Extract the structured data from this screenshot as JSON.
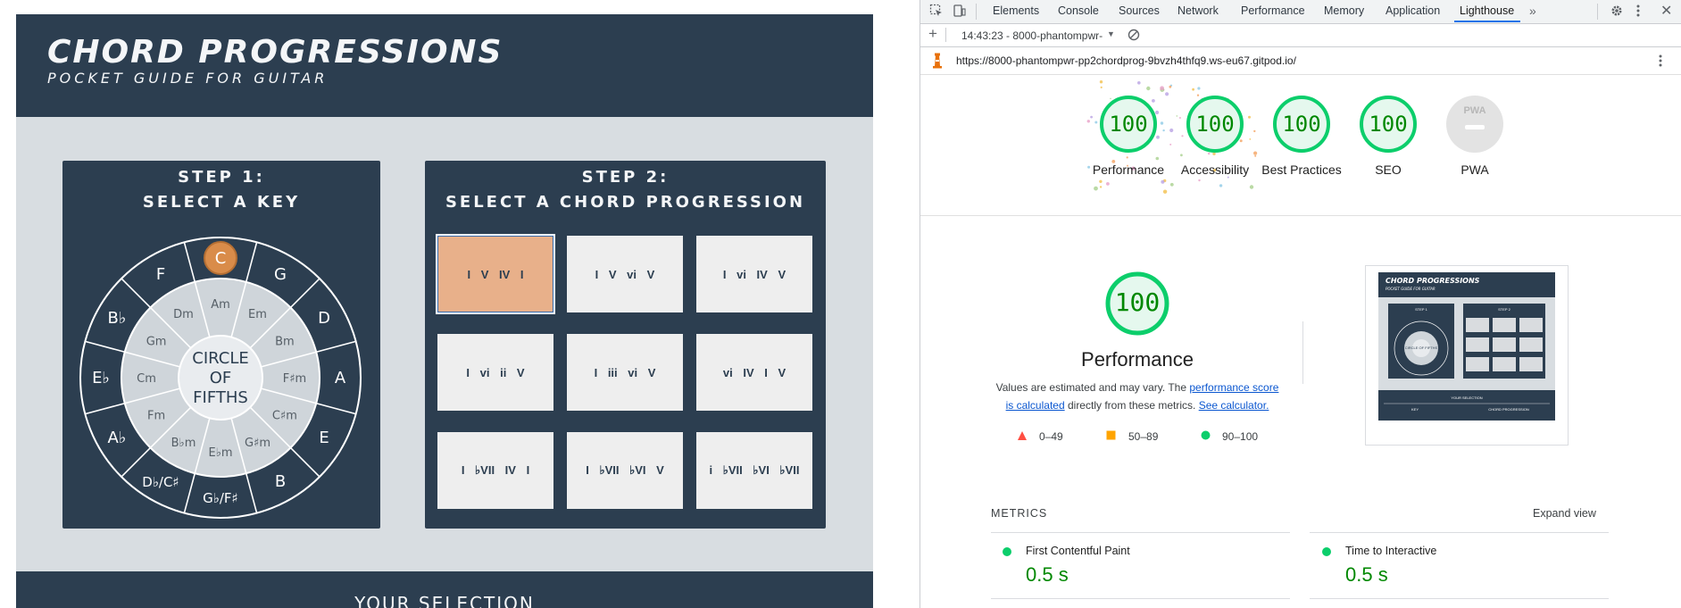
{
  "app": {
    "title": "CHORD PROGRESSIONS",
    "subtitle": "POCKET GUIDE FOR GUITAR",
    "step1": {
      "line1": "STEP 1:",
      "line2": "SELECT A KEY"
    },
    "step2": {
      "line1": "STEP 2:",
      "line2": "SELECT A CHORD PROGRESSION"
    },
    "wheel": {
      "center": [
        "CIRCLE",
        "OF",
        "FIFTHS"
      ],
      "major": [
        "C",
        "G",
        "D",
        "A",
        "E",
        "B",
        "G♭/F♯",
        "D♭/C♯",
        "A♭",
        "E♭",
        "B♭",
        "F"
      ],
      "minor": [
        "Am",
        "Em",
        "Bm",
        "F♯m",
        "C♯m",
        "G♯m",
        "E♭m",
        "B♭m",
        "Fm",
        "Cm",
        "Gm",
        "Dm"
      ],
      "selected_key": "C"
    },
    "progressions": [
      {
        "label": "I  V  IV  I",
        "selected": true
      },
      {
        "label": "I  V  vi  V",
        "selected": false
      },
      {
        "label": "I  vi  IV  V",
        "selected": false
      },
      {
        "label": "I  vi  ii  V",
        "selected": false
      },
      {
        "label": "I  iii  vi  V",
        "selected": false
      },
      {
        "label": "vi  IV  I  V",
        "selected": false
      },
      {
        "label": "I  ♭VII  IV  I",
        "selected": false
      },
      {
        "label": "I  ♭VII  ♭VI  V",
        "selected": false
      },
      {
        "label": "i  ♭VII  ♭VI  ♭VII",
        "selected": false
      }
    ],
    "selection_label": "YOUR SELECTION",
    "colors": {
      "navy": "#2c3e50",
      "accent": "#d98c4a",
      "selected_btn": "#e8b08a",
      "background": "#d8dde1"
    }
  },
  "devtools": {
    "tabs": [
      "Elements",
      "Console",
      "Sources",
      "Network",
      "Performance",
      "Memory",
      "Application",
      "Lighthouse"
    ],
    "active_tab": "Lighthouse",
    "report_selector": "14:43:23 - 8000-phantompwr-",
    "url": "https://8000-phantompwr-pp2chordprog-9bvzh4thfq9.ws-eu67.gitpod.io/",
    "scores": [
      {
        "name": "Performance",
        "value": "100"
      },
      {
        "name": "Accessibility",
        "value": "100"
      },
      {
        "name": "Best Practices",
        "value": "100"
      },
      {
        "name": "SEO",
        "value": "100"
      },
      {
        "name": "PWA",
        "value": ""
      }
    ],
    "pwa_badge": "PWA",
    "performance": {
      "score": "100",
      "title": "Performance",
      "desc_prefix": "Values are estimated and may vary. The ",
      "desc_link1": "performance score is calculated",
      "desc_mid": " directly from these metrics. ",
      "desc_link2": "See calculator."
    },
    "legend": [
      {
        "range": "0–49",
        "color": "#ff4e42"
      },
      {
        "range": "50–89",
        "color": "#ffa400"
      },
      {
        "range": "90–100",
        "color": "#0cce6b"
      }
    ],
    "metrics_title": "METRICS",
    "expand_view": "Expand view",
    "metrics": [
      {
        "name": "First Contentful Paint",
        "value": "0.5 s"
      },
      {
        "name": "Time to Interactive",
        "value": "0.5 s"
      }
    ],
    "screenshot_texts": {
      "title": "CHORD PROGRESSIONS",
      "subtitle": "POCKET GUIDE FOR GUITAR",
      "step1": "STEP 1",
      "step2": "STEP 2",
      "center": "CIRCLE OF FIFTHS",
      "selection": "YOUR SELECTION",
      "key": "KEY",
      "chord_progression": "CHORD PROGRESSION"
    },
    "colors": {
      "pass": "#0cce6b",
      "pass_text": "#008800",
      "link": "#0b57d0",
      "active_tab": "#1a73e8"
    }
  }
}
